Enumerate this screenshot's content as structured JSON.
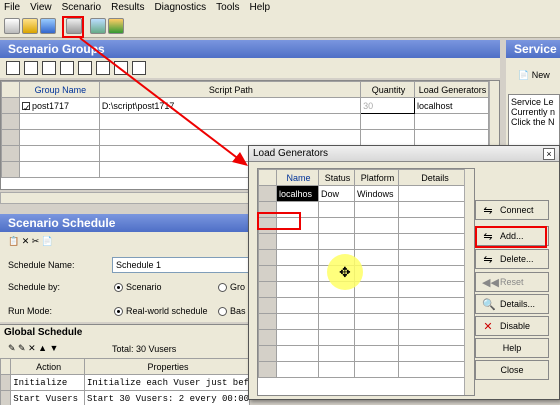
{
  "menu": [
    "File",
    "View",
    "Scenario",
    "Results",
    "Diagnostics",
    "Tools",
    "Help"
  ],
  "scenario_groups": {
    "title": "Scenario Groups",
    "columns": [
      "Group Name",
      "Script Path",
      "Quantity",
      "Load Generators"
    ],
    "rows": [
      {
        "name": "post1717",
        "path": "D:\\script\\post1717",
        "quantity": "30",
        "lg": "localhost"
      }
    ]
  },
  "service": {
    "title": "Service",
    "new_label": "New",
    "text1": "Service Le",
    "text2": "Currently n",
    "text3": "Click the N"
  },
  "schedule": {
    "title": "Scenario Schedule",
    "name_label": "Schedule Name:",
    "name_value": "Schedule 1",
    "by_label": "Schedule by:",
    "by_opt1": "Scenario",
    "by_opt2": "Gro",
    "mode_label": "Run Mode:",
    "mode_opt1": "Real-world schedule",
    "mode_opt2": "Bas"
  },
  "global_schedule": {
    "title": "Global Schedule",
    "total": "Total: 30 Vusers",
    "columns": [
      "Action",
      "Properties"
    ],
    "rows": [
      {
        "action": "Initialize",
        "props": "Initialize each Vuser just bef"
      },
      {
        "action": "Start  Vusers",
        "props": "Start 30 Vusers: 2 every 00:00"
      }
    ]
  },
  "load_generators": {
    "title": "Load Generators",
    "columns": [
      "Name",
      "Status",
      "Platform",
      "Details"
    ],
    "rows": [
      {
        "name": "localhos",
        "status": "Dow",
        "platform": "Windows",
        "details": ""
      }
    ],
    "buttons": {
      "connect": "Connect",
      "add": "Add...",
      "delete": "Delete...",
      "reset": "Reset",
      "details": "Details...",
      "disable": "Disable",
      "help": "Help",
      "close": "Close"
    }
  }
}
